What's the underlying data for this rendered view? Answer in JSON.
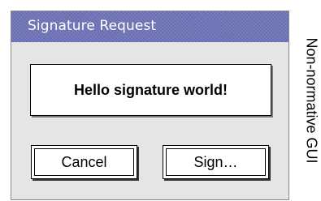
{
  "dialog": {
    "title": "Signature Request",
    "message": "Hello signature world!",
    "buttons": {
      "cancel_label": "Cancel",
      "sign_label": "Sign…"
    }
  },
  "side_note": "Non-normative GUI",
  "colors": {
    "titlebar": "#6f74b8",
    "dialog_background": "#e5e5e5",
    "title_text": "#ffffff"
  }
}
